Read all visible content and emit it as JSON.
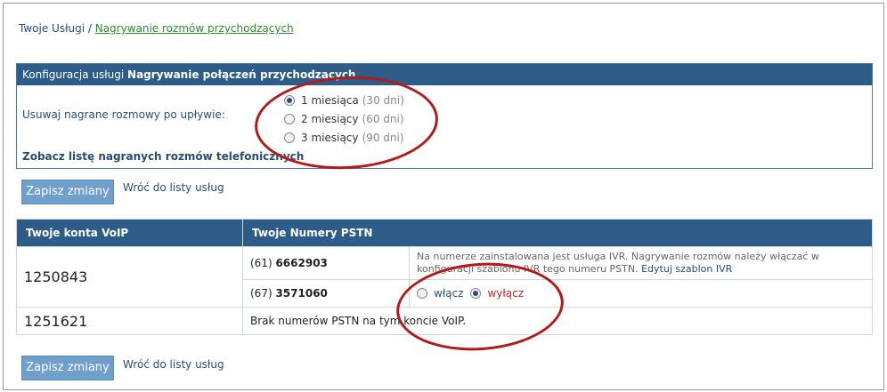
{
  "breadcrumb": {
    "root": "Twoje Usługi",
    "separator": " / ",
    "current": "Nagrywanie rozmów przychodzących"
  },
  "config": {
    "header_prefix": "Konfiguracja usługi ",
    "header_bold": "Nagrywanie połączeń przychodzących",
    "label": "Usuwaj nagrane rozmowy po upływie:",
    "options": [
      {
        "label": "1 miesiąca",
        "hint": "(30 dni)",
        "selected": true
      },
      {
        "label": "2 miesiący",
        "hint": "(60 dni)",
        "selected": false
      },
      {
        "label": "3 miesiący",
        "hint": "(90 dni)",
        "selected": false
      }
    ],
    "list_link": "Zobacz listę nagranych rozmów telefonicznych"
  },
  "actions": {
    "save": "Zapisz zmiany",
    "back": "Wróć do listy usług"
  },
  "table": {
    "headers": {
      "voip": "Twoje konta VoIP",
      "pstn": "Twoje Numery PSTN"
    },
    "rows": {
      "r1": {
        "account": "1250843",
        "n1_prefix": "(61) ",
        "n1_number": "6662903",
        "n1_info": "Na numerze zainstalowana jest usługa IVR. Nagrywanie rozmów należy włączać w konfiguracji szablonu IVR tego numeru PSTN. ",
        "n1_link": "Edytuj szablon IVR",
        "n2_prefix": "(67) ",
        "n2_number": "3571060",
        "toggle_on": "włącz",
        "toggle_off": "wyłącz",
        "toggle_selected": "wyłącz"
      },
      "r2": {
        "account": "1251621",
        "message": "Brak numerów PSTN na tym koncie VoIP."
      }
    }
  },
  "colors": {
    "header": "#2c5c87",
    "button": "#6fa0cc",
    "annotation": "#b21a1a",
    "link_green": "#2f8a2f"
  }
}
